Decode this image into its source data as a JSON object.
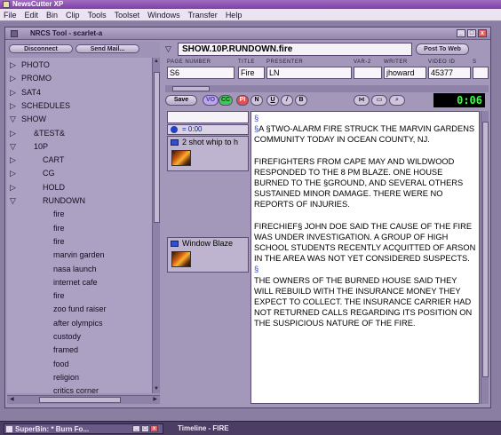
{
  "app": {
    "title": "NewsCutter XP",
    "menu": [
      "File",
      "Edit",
      "Bin",
      "Clip",
      "Tools",
      "Toolset",
      "Windows",
      "Transfer",
      "Help"
    ]
  },
  "nrcs_window": {
    "title": "NRCS Tool - scarlet-a",
    "controls": [
      "_",
      "□",
      "x"
    ],
    "left_pane": {
      "disconnect_label": "Disconnect",
      "send_mail_label": "Send Mail...",
      "tree": [
        {
          "label": "PHOTO",
          "state": "collapsed",
          "indent": 0
        },
        {
          "label": "PROMO",
          "state": "collapsed",
          "indent": 0
        },
        {
          "label": "SAT4",
          "state": "collapsed",
          "indent": 0
        },
        {
          "label": "SCHEDULES",
          "state": "collapsed",
          "indent": 0
        },
        {
          "label": "SHOW",
          "state": "expanded",
          "indent": 0
        },
        {
          "label": "&TEST&",
          "state": "collapsed",
          "indent": 1
        },
        {
          "label": "10P",
          "state": "expanded",
          "indent": 1
        },
        {
          "label": "CART",
          "state": "collapsed",
          "indent": 2
        },
        {
          "label": "CG",
          "state": "collapsed",
          "indent": 2
        },
        {
          "label": "HOLD",
          "state": "collapsed",
          "indent": 2
        },
        {
          "label": "RUNDOWN",
          "state": "expanded",
          "indent": 2
        },
        {
          "label": "fire",
          "state": "leaf",
          "indent": 3
        },
        {
          "label": "fire",
          "state": "leaf",
          "indent": 3
        },
        {
          "label": "fire",
          "state": "leaf",
          "indent": 3
        },
        {
          "label": "marvin garden",
          "state": "leaf",
          "indent": 3
        },
        {
          "label": "nasa launch",
          "state": "leaf",
          "indent": 3
        },
        {
          "label": "internet cafe",
          "state": "leaf",
          "indent": 3
        },
        {
          "label": "fire",
          "state": "leaf",
          "indent": 3
        },
        {
          "label": "zoo fund raiser",
          "state": "leaf",
          "indent": 3
        },
        {
          "label": "after olympics",
          "state": "leaf",
          "indent": 3
        },
        {
          "label": "custody",
          "state": "leaf",
          "indent": 3
        },
        {
          "label": "framed",
          "state": "leaf",
          "indent": 3
        },
        {
          "label": "food",
          "state": "leaf",
          "indent": 3
        },
        {
          "label": "religion",
          "state": "leaf",
          "indent": 3
        },
        {
          "label": "critics corner",
          "state": "leaf",
          "indent": 3
        }
      ]
    },
    "rundown": {
      "title": "SHOW.10P.RUNDOWN.fire",
      "post_button": "Post To Web",
      "fields": [
        {
          "label": "PAGE NUMBER",
          "value": "S6"
        },
        {
          "label": "TITLE",
          "value": "Fire"
        },
        {
          "label": "PRESENTER",
          "value": "LN"
        },
        {
          "label": "VAR-2",
          "value": ""
        },
        {
          "label": "WRITER",
          "value": "jhoward"
        },
        {
          "label": "VIDEO ID",
          "value": "45377"
        },
        {
          "label": "S",
          "value": ""
        }
      ]
    },
    "toolbar": {
      "save": "Save",
      "pills": [
        "VO",
        "CC",
        "PI",
        "N",
        "U",
        "/",
        "B"
      ],
      "timecode": "0:06"
    },
    "cues": {
      "time_label": "= 0:00",
      "clips": [
        {
          "label": "2 shot whip to h"
        },
        {
          "label": "Window Blaze"
        }
      ]
    },
    "script": {
      "mark": "§",
      "paragraphs": [
        "A §TWO-ALARM FIRE STRUCK THE MARVIN GARDENS COMMUNITY TODAY IN OCEAN COUNTY, NJ.",
        "FIREFIGHTERS FROM CAPE MAY AND WILDWOOD RESPONDED TO THE 8 PM BLAZE. ONE HOUSE BURNED TO THE §GROUND, AND SEVERAL OTHERS SUSTAINED MINOR DAMAGE. THERE WERE NO REPORTS OF INJURIES.",
        "FIRECHIEF§ JOHN DOE SAID THE CAUSE OF THE FIRE WAS UNDER INVESTIGATION. A GROUP OF HIGH SCHOOL STUDENTS RECENTLY ACQUITTED OF ARSON IN THE AREA WAS NOT YET CONSIDERED SUSPECTS.",
        "THE OWNERS OF THE BURNED HOUSE SAID THEY WILL REBUILD WITH THE INSURANCE MONEY THEY EXPECT TO COLLECT. THE INSURANCE CARRIER HAD NOT RETURNED CALLS REGARDING ITS POSITION ON THE SUSPICIOUS NATURE OF THE FIRE."
      ]
    }
  },
  "taskbar": {
    "superbin": "SuperBin: * Burn Fo...",
    "timeline": "Timeline - FIRE"
  }
}
